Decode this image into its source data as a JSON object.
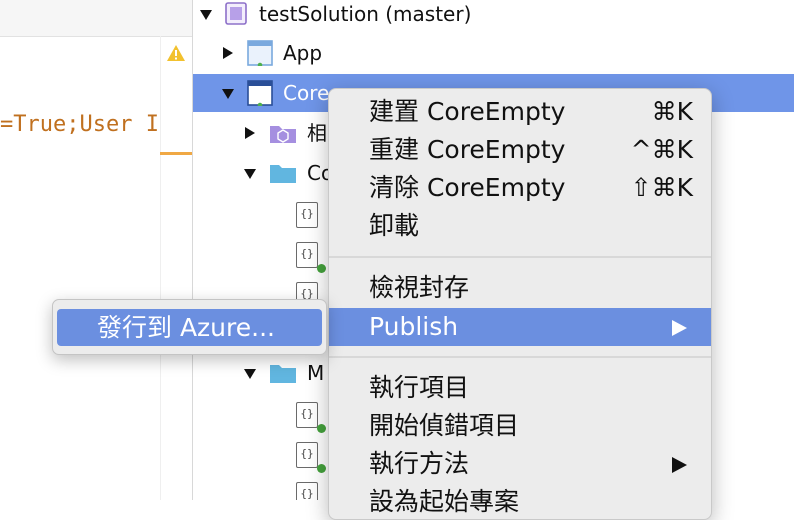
{
  "editor": {
    "code_text": "=True;User I",
    "warning_icon": "warning-icon"
  },
  "tree": {
    "solution_label": "testSolution (master)",
    "items": [
      {
        "label": "App",
        "icon": "project-icon"
      },
      {
        "label": "CoreEmpty",
        "icon": "project-icon",
        "selected": true,
        "visible_text": "Core"
      },
      {
        "label": "相",
        "icon": "references-icon"
      },
      {
        "label": "Co",
        "icon": "folder-icon"
      },
      {
        "label": "M",
        "icon": "folder-icon"
      }
    ]
  },
  "context_menu": {
    "build": {
      "label": "建置 CoreEmpty",
      "shortcut": "⌘K"
    },
    "rebuild": {
      "label": "重建 CoreEmpty",
      "shortcut": "^⌘K"
    },
    "clean": {
      "label": "清除 CoreEmpty",
      "shortcut": "⇧⌘K"
    },
    "unload": {
      "label": "卸載"
    },
    "view_archive": {
      "label": "檢視封存"
    },
    "publish": {
      "label": "Publish",
      "has_submenu": true,
      "highlighted": true
    },
    "run_item": {
      "label": "執行項目"
    },
    "start_debug_item": {
      "label": "開始偵錯項目"
    },
    "run_method": {
      "label": "執行方法",
      "has_submenu": true
    },
    "set_startup": {
      "label": "設為起始專案"
    }
  },
  "publish_submenu": {
    "publish_azure": {
      "label": "發行到 Azure..."
    }
  },
  "colors": {
    "selection": "#6f95e8",
    "menu_highlight": "#6b8fe0",
    "code_orange": "#c0701f",
    "folder_blue": "#61b6e0"
  }
}
